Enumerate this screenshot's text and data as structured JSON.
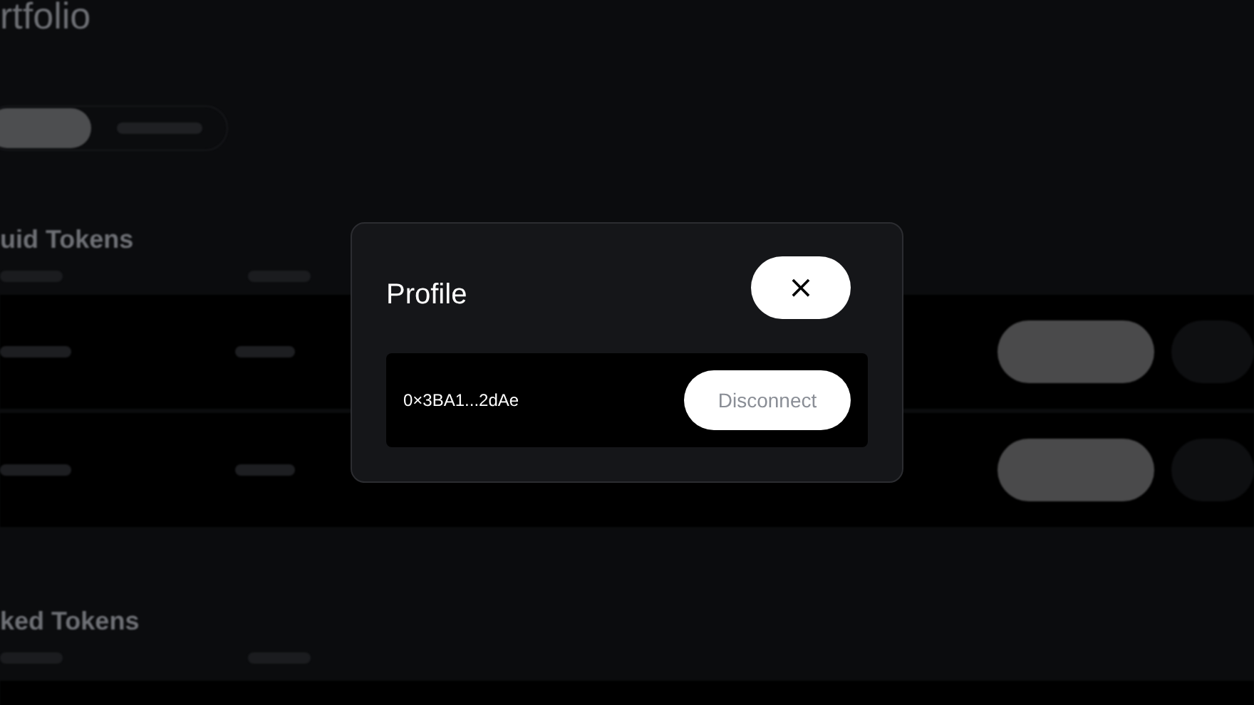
{
  "background": {
    "page_title": "rtfolio",
    "sections": [
      {
        "title": "uid Tokens"
      },
      {
        "title": "ked Tokens"
      }
    ]
  },
  "dialog": {
    "title": "Profile",
    "close_label": "×",
    "address": "0×3BA1...2dAe",
    "disconnect_label": "Disconnect"
  }
}
